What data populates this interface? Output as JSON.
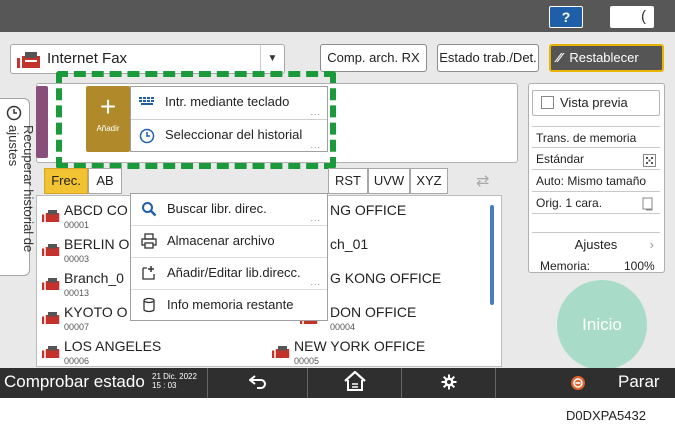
{
  "topbar": {
    "help_label": "?",
    "moon_label": "("
  },
  "header": {
    "function_label": "Internet Fax",
    "comp_arch_rx": "Comp. arch. RX",
    "estado_trab": "Estado trab./Det.",
    "restablecer": "Restablecer"
  },
  "side_tab": {
    "label": "Recuperar historial de ajustes"
  },
  "add_button": {
    "label": "Añadir"
  },
  "popup_top": {
    "items": [
      {
        "label": "Intr. mediante teclado",
        "icon": "keyboard-icon"
      },
      {
        "label": "Seleccionar del historial",
        "icon": "clock-icon"
      }
    ]
  },
  "tabs": [
    "Frec.",
    "AB",
    "RST",
    "UVW",
    "XYZ"
  ],
  "list": {
    "entries": [
      {
        "name": "ABCD CO",
        "num": "00001"
      },
      {
        "name": "BERLIN O",
        "num": "00003"
      },
      {
        "name": "Branch_0",
        "num": "00013"
      },
      {
        "name": "KYOTO O",
        "num": "00007"
      },
      {
        "name": "LOS ANGELES",
        "num": "00006"
      },
      {
        "name": "NG OFFICE",
        "num": ""
      },
      {
        "name": "ch_01",
        "num": ""
      },
      {
        "name": "G KONG OFFICE",
        "num": ""
      },
      {
        "name": "DON OFFICE",
        "num": "00004"
      },
      {
        "name": "NEW YORK OFFICE",
        "num": "00005"
      }
    ]
  },
  "popup_menu": {
    "items": [
      {
        "label": "Buscar libr. direc.",
        "icon": "search-icon"
      },
      {
        "label": "Almacenar archivo",
        "icon": "printer-icon"
      },
      {
        "label": "Añadir/Editar lib.direcc.",
        "icon": "edit-icon"
      },
      {
        "label": "Info memoria restante",
        "icon": "database-icon"
      }
    ]
  },
  "right_panel": {
    "vista_previa": "Vista previa",
    "settings": [
      "Trans. de memoria",
      "Estándar",
      "Auto: Mismo tamaño",
      "Orig. 1 cara."
    ],
    "ajustes": "Ajustes",
    "memoria_label": "Memoria:",
    "memoria_value": "100%",
    "start_label": "Inicio"
  },
  "bottombar": {
    "status_label": "Comprobar estado",
    "date_line1": "21 Dic. 2022",
    "date_line2": "15 : 03",
    "stop_label": "Parar"
  },
  "figure_code": "D0DXPA5432"
}
